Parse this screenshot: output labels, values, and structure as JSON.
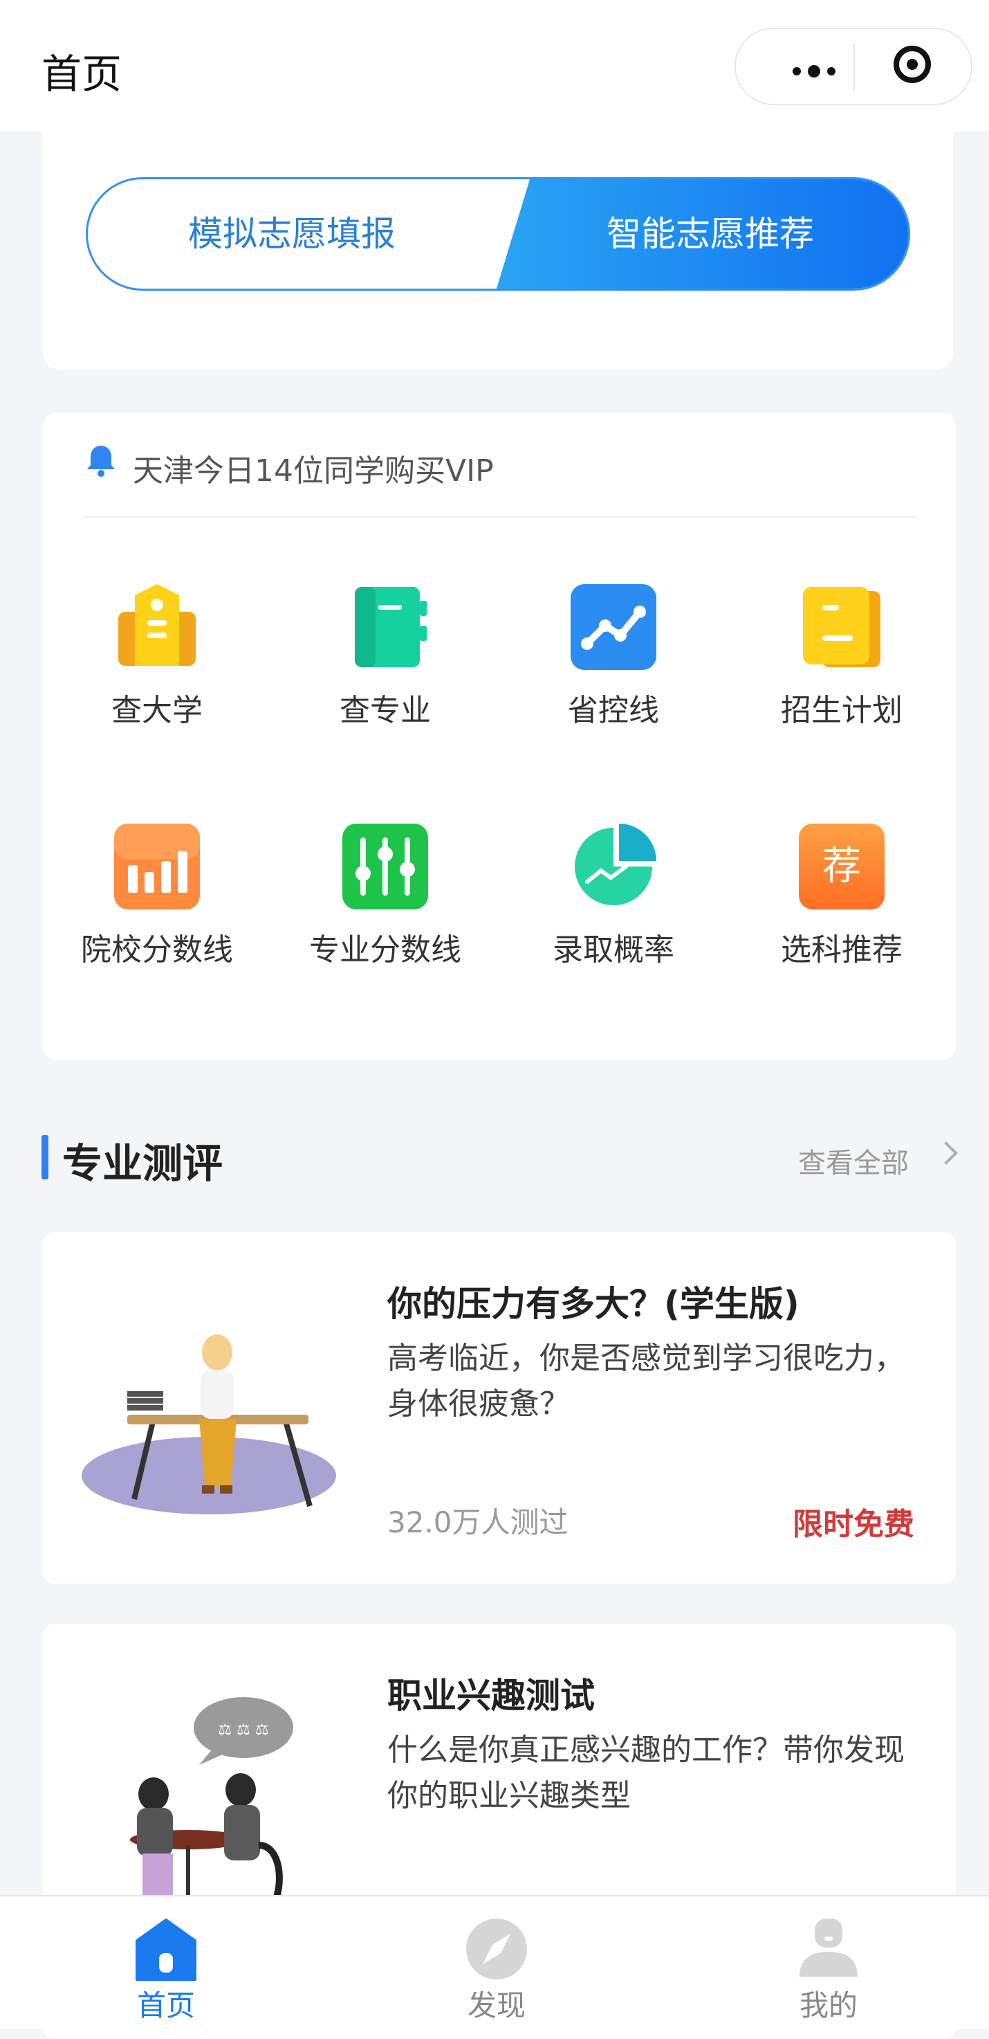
{
  "header": {
    "title": "首页"
  },
  "mode_toggle": {
    "left_label": "模拟志愿填报",
    "right_label": "智能志愿推荐"
  },
  "notice": {
    "text": "天津今日14位同学购买VIP"
  },
  "grid": [
    {
      "label": "查大学",
      "icon": "university-icon"
    },
    {
      "label": "查专业",
      "icon": "major-book-icon"
    },
    {
      "label": "省控线",
      "icon": "trend-line-icon"
    },
    {
      "label": "招生计划",
      "icon": "enrollment-plan-icon"
    },
    {
      "label": "院校分数线",
      "icon": "bar-chart-icon"
    },
    {
      "label": "专业分数线",
      "icon": "sliders-icon"
    },
    {
      "label": "录取概率",
      "icon": "pie-chart-icon"
    },
    {
      "label": "选科推荐",
      "icon": "recommend-badge-icon",
      "badge_char": "荐"
    }
  ],
  "section": {
    "title": "专业测评",
    "view_all": "查看全部"
  },
  "assessments": [
    {
      "title": "你的压力有多大？(学生版)",
      "desc": "高考临近，你是否感觉到学习很吃力，身体很疲惫？",
      "count": "32.0万人测过",
      "badge": "限时免费"
    },
    {
      "title": "职业兴趣测试",
      "desc": "什么是你真正感兴趣的工作？带你发现你的职业兴趣类型"
    }
  ],
  "tabbar": [
    {
      "label": "首页",
      "active": true
    },
    {
      "label": "发现",
      "active": false
    },
    {
      "label": "我的",
      "active": false
    }
  ],
  "colors": {
    "accent": "#1c7af0",
    "badge_red": "#d33a3a"
  }
}
